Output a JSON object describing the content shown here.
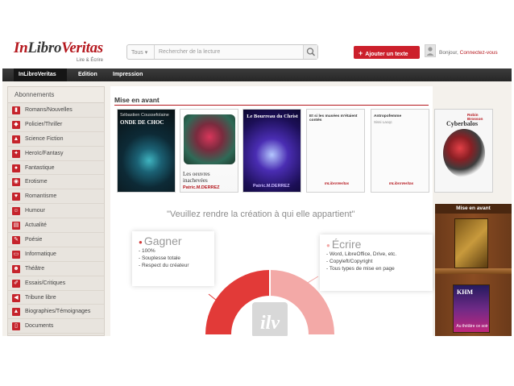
{
  "header": {
    "logo": {
      "part1": "In",
      "part2": "Libro",
      "part3": "Veritas"
    },
    "tagline": "Lire & Écrire",
    "search": {
      "category": "Tous",
      "placeholder": "Rechercher de la lecture"
    },
    "add_button": "Ajouter un texte",
    "greeting": "Bonjour,",
    "login_link": "Connectez-vous"
  },
  "nav": [
    "InLibroVeritas",
    "Edition",
    "Impression"
  ],
  "sidebar": {
    "title": "Abonnements",
    "items": [
      {
        "label": "Romans/Nouvelles",
        "icon": "book-icon"
      },
      {
        "label": "Policier/Thriller",
        "icon": "detective-icon"
      },
      {
        "label": "Science Fiction",
        "icon": "rocket-icon"
      },
      {
        "label": "Heroïc/Fantasy",
        "icon": "sword-icon"
      },
      {
        "label": "Fantastique",
        "icon": "ghost-icon"
      },
      {
        "label": "Erotisme",
        "icon": "lips-icon"
      },
      {
        "label": "Romantisme",
        "icon": "heart-icon"
      },
      {
        "label": "Humour",
        "icon": "smile-icon"
      },
      {
        "label": "Actualité",
        "icon": "news-icon"
      },
      {
        "label": "Poésie",
        "icon": "quill-icon"
      },
      {
        "label": "Informatique",
        "icon": "computer-icon"
      },
      {
        "label": "Théâtre",
        "icon": "masks-icon"
      },
      {
        "label": "Essais/Critiques",
        "icon": "pen-icon"
      },
      {
        "label": "Tribune libre",
        "icon": "megaphone-icon"
      },
      {
        "label": "Biographies/Témoignages",
        "icon": "person-icon"
      },
      {
        "label": "Documents",
        "icon": "document-icon"
      }
    ]
  },
  "main": {
    "title": "Mise en avant",
    "covers": [
      {
        "author": "Sébastien Coussefolaine",
        "title": "ONDE DE CHOC"
      },
      {
        "title": "Les oeuvres inachevées",
        "author": "Patric.M.DERREZ"
      },
      {
        "title": "Le Bourreau du Christ",
        "author": "Patric.M.DERREZ"
      },
      {
        "title": "Et si les musées m'étaient contés",
        "brand": "InLibroVeritas"
      },
      {
        "title": "Antropofemme",
        "author": "Sissi Lacqc",
        "brand": "InLibroVeritas"
      },
      {
        "author": "Robin Brosson",
        "title": "Cyberbalos"
      }
    ],
    "quote": "\"Veuillez rendre la création à qui elle appartient\"",
    "donut_logo": "ilv",
    "gagner": {
      "title": "Gagner",
      "lines": [
        "- 100%",
        "- Souplesse totale",
        "- Respect du créateur"
      ]
    },
    "ecrire": {
      "title": "Écrire",
      "lines": [
        "- Word, LibreOffice, Drive, etc.",
        "- Copyleft/Copyright",
        "- Tous types de mise en page"
      ]
    }
  },
  "shelf": {
    "title": "Mise en avant",
    "book2_title": "KHM",
    "book2_sub": "Au théâtre ce soir"
  },
  "colors": {
    "brand_red": "#b5181e",
    "button_red": "#cc1f2b",
    "nav_dark": "#2b2b2b"
  }
}
